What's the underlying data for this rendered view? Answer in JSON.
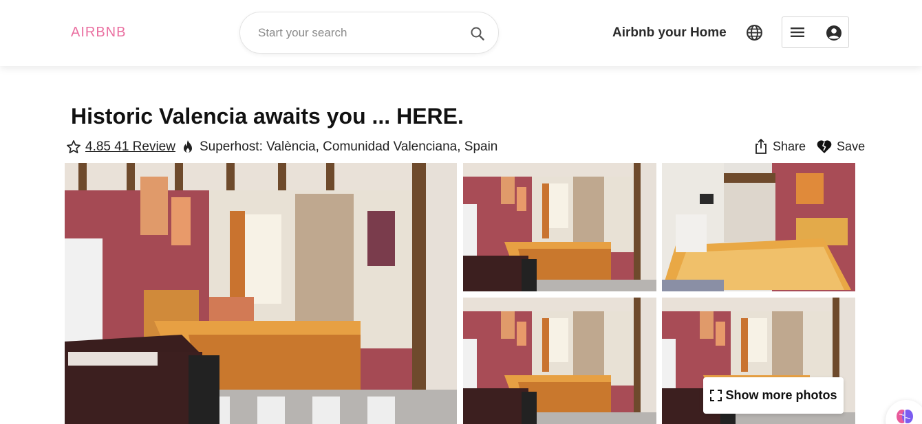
{
  "header": {
    "logo": "AIRBNB",
    "search_placeholder": "Start your search",
    "host_link": "Airbnb your Home"
  },
  "listing": {
    "title": "Historic Valencia awaits you ... HERE.",
    "rating": "4.85 41 Review",
    "location": "Superhost: València, Comunidad Valenciana, Spain",
    "share_label": "Share",
    "save_label": "Save"
  },
  "gallery": {
    "show_more_label": "Show more photos"
  },
  "colors": {
    "brand": "#ea6fa0",
    "wall": "#b04a55"
  },
  "icons": [
    "search-icon",
    "globe-icon",
    "menu-icon",
    "user-icon",
    "star-icon",
    "fire-icon",
    "share-icon",
    "save-icon",
    "expand-icon",
    "brain-icon"
  ]
}
